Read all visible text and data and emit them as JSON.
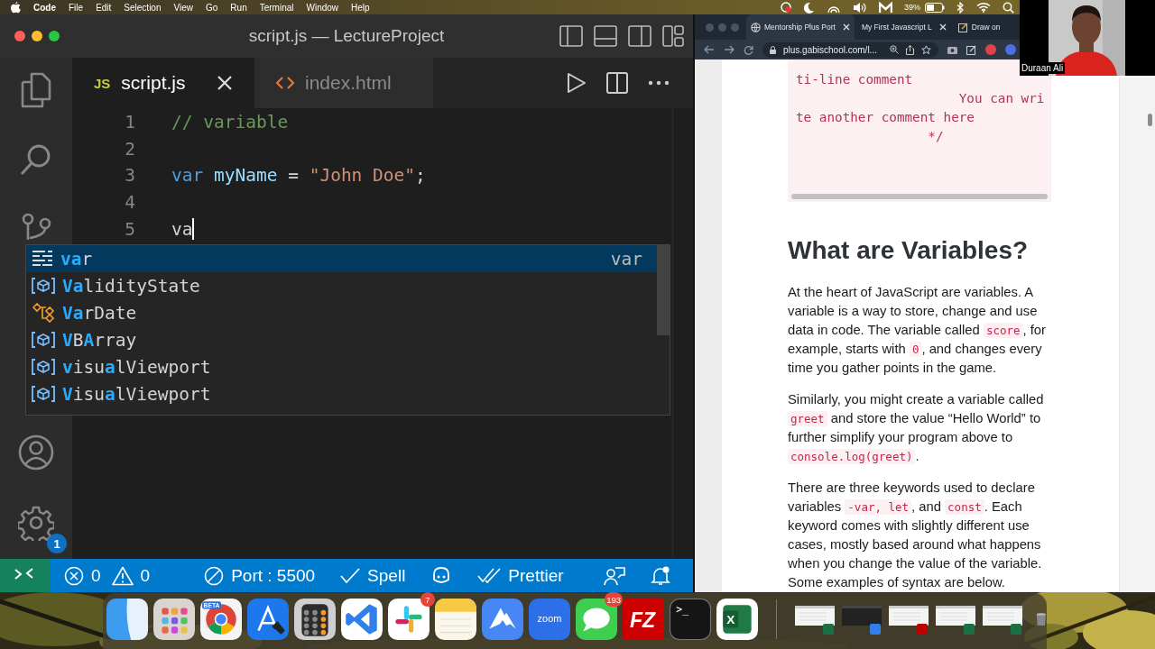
{
  "menu_bar": {
    "app": "Code",
    "items": [
      "File",
      "Edit",
      "Selection",
      "View",
      "Go",
      "Run",
      "Terminal",
      "Window",
      "Help"
    ],
    "battery": "39%"
  },
  "editor": {
    "title": "script.js — LectureProject",
    "tabs": [
      {
        "label": "script.js",
        "kind": "js",
        "icon_label": "JS",
        "selected": true
      },
      {
        "label": "index.html",
        "kind": "html",
        "selected": false
      }
    ],
    "lines": [
      {
        "number": "1",
        "tokens": [
          {
            "kind": "comment",
            "text": "// variable"
          }
        ]
      },
      {
        "number": "2"
      },
      {
        "number": "3",
        "tokens": [
          {
            "kind": "keyword",
            "text": "var"
          },
          {
            "kind": "variable",
            "text": " myName"
          },
          {
            "kind": "plain",
            "text": " = "
          },
          {
            "kind": "string",
            "text": "\"John Doe\""
          },
          {
            "kind": "plain",
            "text": ";"
          }
        ]
      },
      {
        "number": "4"
      },
      {
        "number": "5",
        "cursor": true,
        "tokens": [
          {
            "kind": "plain",
            "text": "va"
          }
        ]
      }
    ],
    "suggestions": [
      {
        "kind": "keyword",
        "label": "**va**r",
        "detail": "var",
        "selected": true
      },
      {
        "kind": "interface",
        "label": "**Va**lidityState",
        "selected": false
      },
      {
        "kind": "class",
        "label": "**Va**rDate",
        "selected": false
      },
      {
        "kind": "interface",
        "label": "**V**B**A**rray",
        "selected": false
      },
      {
        "kind": "interface",
        "label": "**v**isu**a**lViewport",
        "selected": false
      },
      {
        "kind": "interface",
        "label": "**V**isu**a**lViewport",
        "selected": false
      }
    ],
    "settings_badge": "1",
    "status_bar": {
      "errors": "0",
      "warnings": "0",
      "port": "Port : 5500",
      "spell": "Spell",
      "prettier": "Prettier"
    }
  },
  "browser": {
    "tabs": [
      {
        "label": "Mentorship Plus Port",
        "selected": true
      },
      {
        "label": "My First Javascript L",
        "selected": false
      },
      {
        "label": "Draw on",
        "selected": false
      }
    ],
    "url": "plus.gabischool.com/l...",
    "code_lines": [
      "ti-line comment",
      "                     You can wri",
      "te another comment here",
      "                 */"
    ],
    "heading": "What are Variables?",
    "paragraphs": [
      [
        {
          "text": "At the heart of JavaScript are variables. A variable is a way to store, change and use data in code. The variable called ",
          "kind": "text"
        },
        {
          "text": "score",
          "kind": "code"
        },
        {
          "text": ", for example, starts with ",
          "kind": "text"
        },
        {
          "text": "0",
          "kind": "code"
        },
        {
          "text": ", and changes every time you gather points in the game.",
          "kind": "text"
        }
      ],
      [
        {
          "text": "Similarly, you might create a variable called ",
          "kind": "text"
        },
        {
          "text": "greet",
          "kind": "code"
        },
        {
          "text": " and store the value “Hello World” to further simplify your program above to ",
          "kind": "text"
        },
        {
          "text": "console.log(greet)",
          "kind": "code"
        },
        {
          "text": ".",
          "kind": "text"
        }
      ],
      [
        {
          "text": "There are three keywords used to declare variables ",
          "kind": "text"
        },
        {
          "text": "-var, let",
          "kind": "code"
        },
        {
          "text": ", and ",
          "kind": "text"
        },
        {
          "text": "const",
          "kind": "code"
        },
        {
          "text": ". Each keyword comes with slightly different use cases, mostly based around what happens when you change the value of the variable. Some examples of syntax are below.",
          "kind": "text"
        }
      ]
    ]
  },
  "webcam": {
    "name": "Duraan Ali"
  },
  "dock": {
    "apps": [
      {
        "kind": "finder"
      },
      {
        "kind": "launchpad"
      },
      {
        "kind": "chrome",
        "label": "BETA"
      },
      {
        "kind": "xcode"
      },
      {
        "kind": "calculator"
      },
      {
        "kind": "vscode"
      },
      {
        "kind": "slack",
        "badge": "7"
      },
      {
        "kind": "notes"
      },
      {
        "kind": "vpn"
      },
      {
        "kind": "zoom",
        "label": "zoom"
      },
      {
        "kind": "messages",
        "badge": "193"
      },
      {
        "kind": "filezilla",
        "label": "FZ"
      },
      {
        "kind": "terminal",
        "label": ">_"
      },
      {
        "kind": "excel",
        "label": "X"
      }
    ],
    "windows": [
      {
        "kind": "excel"
      },
      {
        "kind": "vscode"
      },
      {
        "kind": "filezilla"
      },
      {
        "kind": "excel"
      },
      {
        "kind": "excel"
      }
    ]
  }
}
